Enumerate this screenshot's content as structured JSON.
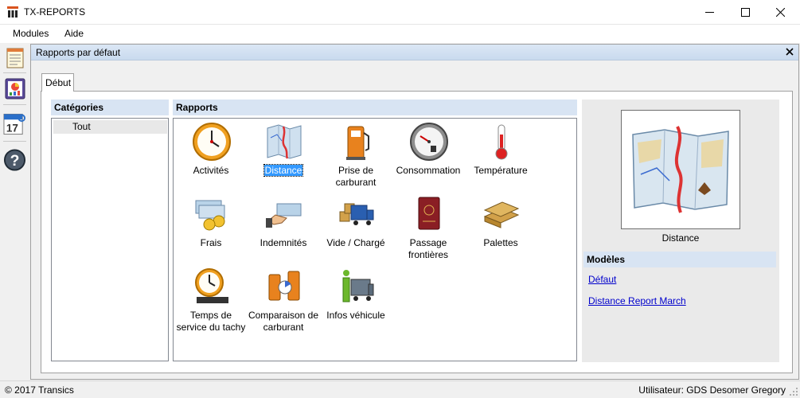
{
  "app": {
    "title": "TX-REPORTS"
  },
  "menu": {
    "items": [
      "Modules",
      "Aide"
    ]
  },
  "toolbar": {
    "icons": [
      "report-icon",
      "chart-icon",
      "calendar-icon",
      "help-icon"
    ],
    "calendar_day": "17"
  },
  "child_window": {
    "title": "Rapports par défaut",
    "tab": "Début",
    "categories_header": "Catégories",
    "categories": [
      "Tout"
    ],
    "reports_header": "Rapports",
    "reports": [
      {
        "label": "Activités",
        "icon": "clock-icon"
      },
      {
        "label": "Distance",
        "icon": "map-icon",
        "selected": true
      },
      {
        "label": "Prise de carburant",
        "icon": "fuel-pump-icon"
      },
      {
        "label": "Consommation",
        "icon": "gauge-icon"
      },
      {
        "label": "Température",
        "icon": "thermometer-icon"
      },
      {
        "label": "Frais",
        "icon": "money-icon"
      },
      {
        "label": "Indemnités",
        "icon": "cash-hand-icon"
      },
      {
        "label": "Vide / Chargé",
        "icon": "truck-boxes-icon"
      },
      {
        "label": "Passage frontières",
        "icon": "passport-icon"
      },
      {
        "label": "Palettes",
        "icon": "pallets-icon"
      },
      {
        "label": "Temps de service du tachy",
        "icon": "tachograph-icon"
      },
      {
        "label": "Comparaison de carburant",
        "icon": "fuel-compare-icon"
      },
      {
        "label": "Infos véhicule",
        "icon": "vehicle-info-icon"
      }
    ],
    "preview": {
      "caption": "Distance",
      "icon": "map-icon"
    },
    "models_header": "Modèles",
    "models": [
      "Défaut",
      "Distance Report March"
    ]
  },
  "status": {
    "left": "© 2017 Transics",
    "right": "Utilisateur: GDS Desomer Gregory"
  },
  "colors": {
    "header_bg": "#d8e4f3",
    "selection": "#3399ff",
    "link": "#0000cc"
  }
}
